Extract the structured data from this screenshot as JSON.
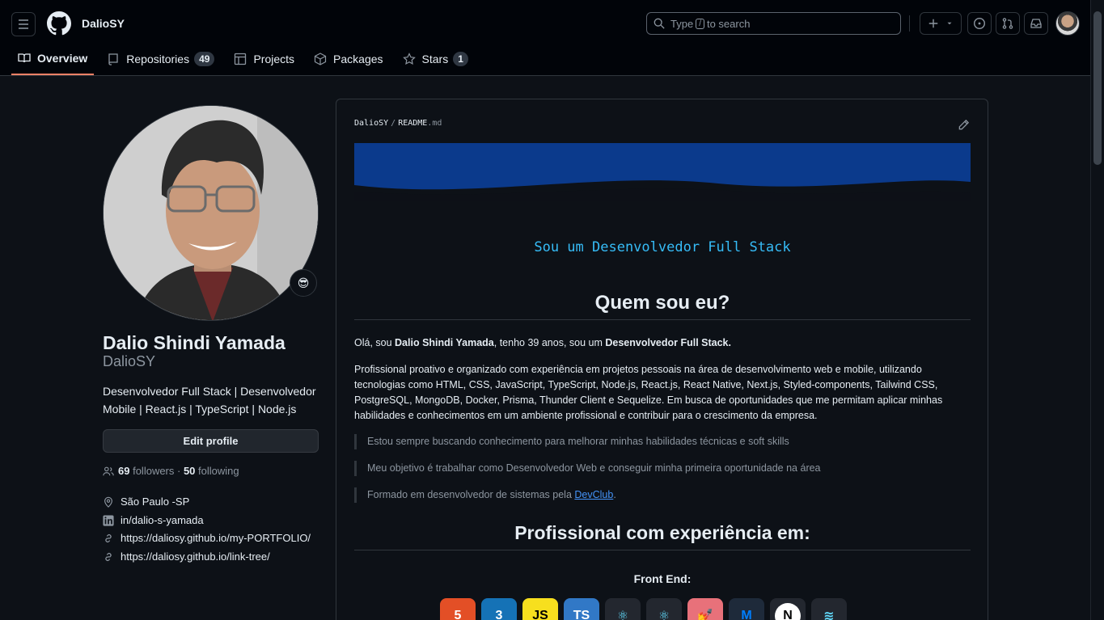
{
  "header": {
    "username": "DalioSY",
    "search_prefix": "Type",
    "search_key": "/",
    "search_suffix": "to search"
  },
  "tabs": [
    {
      "label": "Overview",
      "icon": "book-icon",
      "active": true
    },
    {
      "label": "Repositories",
      "icon": "repo-icon",
      "count": "49"
    },
    {
      "label": "Projects",
      "icon": "table-icon"
    },
    {
      "label": "Packages",
      "icon": "package-icon"
    },
    {
      "label": "Stars",
      "icon": "star-icon",
      "count": "1"
    }
  ],
  "profile": {
    "status_emoji": "😎",
    "full_name": "Dalio Shindi Yamada",
    "login": "DalioSY",
    "bio": "Desenvolvedor Full Stack | Desenvolvedor Mobile | React.js | TypeScript | Node.js",
    "edit_label": "Edit profile",
    "followers_count": "69",
    "followers_label": "followers",
    "following_count": "50",
    "following_label": "following",
    "location": "São Paulo -SP",
    "linkedin": "in/dalio-s-yamada",
    "link1": "https://daliosy.github.io/my-PORTFOLIO/",
    "link2": "https://daliosy.github.io/link-tree/"
  },
  "readme": {
    "owner": "DalioSY",
    "file_name": "README",
    "file_ext": ".md",
    "typing_text": "Sou um Desenvolvedor Full Stack",
    "heading1": "Quem sou eu?",
    "intro_prefix": "Olá, sou ",
    "intro_name": "Dalio Shindi Yamada",
    "intro_mid": ", tenho 39 anos, sou um ",
    "intro_role": "Desenvolvedor Full Stack.",
    "paragraph": "Profissional proativo e organizado com experiência em projetos pessoais na área de desenvolvimento web e mobile, utilizando tecnologias como HTML, CSS, JavaScript, TypeScript, Node.js, React.js, React Native, Next.js, Styled-components, Tailwind CSS, PostgreSQL, MongoDB, Docker, Prisma, Thunder Client e Sequelize. Em busca de oportunidades que me permitam aplicar minhas habilidades e conhecimentos em um ambiente profissional e contribuir para o crescimento da empresa.",
    "quote1": "Estou sempre buscando conhecimento para melhorar minhas habilidades técnicas e soft skills",
    "quote2": "Meu objetivo é trabalhar como Desenvolvedor Web e conseguir minha primeira oportunidade na área",
    "quote3_prefix": "Formado em desenvolvedor de sistemas pela ",
    "quote3_link": "DevClub",
    "quote3_suffix": ".",
    "heading2": "Profissional com experiência em:",
    "frontend_label": "Front End:",
    "tech_icons": [
      {
        "name": "html5-icon",
        "text": "5",
        "color": "#e34f26"
      },
      {
        "name": "css3-icon",
        "text": "3",
        "color": "#1572b6"
      },
      {
        "name": "javascript-icon",
        "text": "JS",
        "color": "#f7df1e"
      },
      {
        "name": "typescript-icon",
        "text": "TS",
        "color": "#3178c6"
      },
      {
        "name": "react-icon",
        "text": "⚛",
        "color": "#23272f"
      },
      {
        "name": "react-native-icon",
        "text": "⚛",
        "color": "#23272f"
      },
      {
        "name": "styled-components-icon",
        "text": "💅",
        "color": "#e8717a"
      },
      {
        "name": "material-ui-icon",
        "text": "M",
        "color": "#1e2a3a"
      },
      {
        "name": "nextjs-icon",
        "text": "N",
        "color": "#23272f"
      },
      {
        "name": "tailwind-icon",
        "text": "≋",
        "color": "#23272f"
      }
    ]
  }
}
